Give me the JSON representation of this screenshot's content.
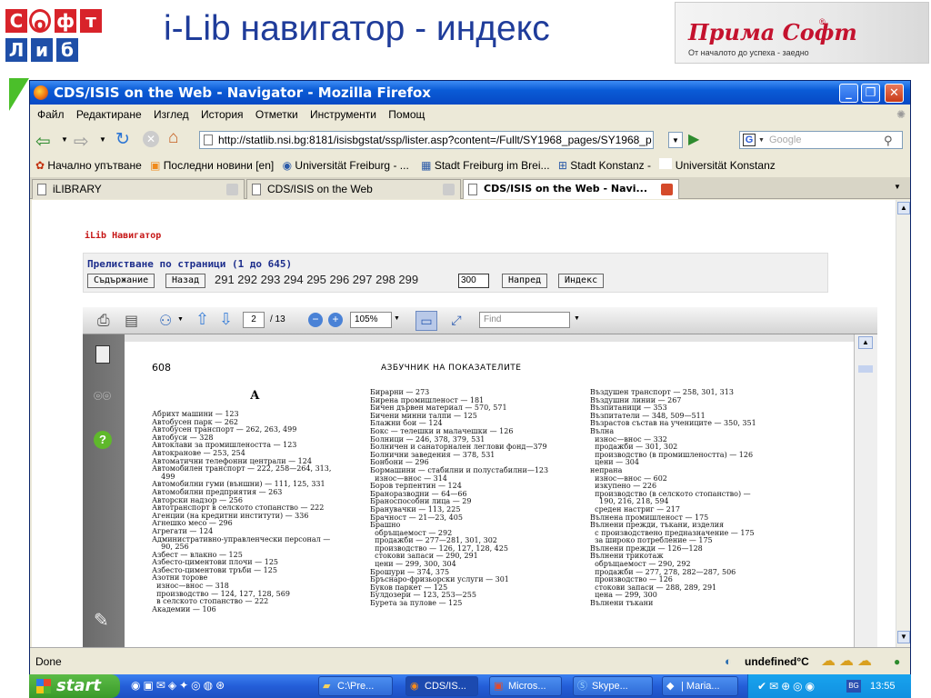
{
  "slide": {
    "logo_letters": [
      "С",
      "о",
      "ф",
      "т",
      "Л",
      "и",
      "б"
    ],
    "title": "i-Lib навигатор - индекс",
    "brand_name": "Прима Софт",
    "brand_reg": "®",
    "brand_tagline": "От началото до успеха - заедно"
  },
  "window": {
    "title": "CDS/ISIS on the Web - Navigator - Mozilla Firefox",
    "controls": [
      "minimize",
      "maximize",
      "close"
    ]
  },
  "menu": [
    "Файл",
    "Редактиране",
    "Изглед",
    "История",
    "Отметки",
    "Инструменти",
    "Помощ"
  ],
  "nav": {
    "url": "http://statlib.nsi.bg:8181/isisbgstat/ssp/lister.asp?content=/Fullt/SY1968_pages/SY1968_p",
    "search_engine_letter": "G",
    "search_placeholder": "Google"
  },
  "bookmarks": [
    "Начално упътване",
    "Последни новини [en]",
    "Universität Freiburg - ...",
    "Stadt Freiburg im Brei...",
    "Stadt Konstanz -",
    "Universität Konstanz"
  ],
  "tabs": [
    {
      "label": "iLIBRARY",
      "active": false
    },
    {
      "label": "CDS/ISIS on the Web",
      "active": false
    },
    {
      "label": "CDS/ISIS on the Web - Navi...",
      "active": true
    }
  ],
  "page": {
    "heading": "iLib Навигатор",
    "browse_label": "Прелистване по страници (1 до 645)",
    "contents_button": "Съдържание",
    "back_button": "Назад",
    "pages": "291 292 293 294 295 296 297 298 299",
    "page_input": "300",
    "next_button": "Напред",
    "index_button": "Индекс"
  },
  "pdf": {
    "page_current": "2",
    "page_total": "/ 13",
    "zoom": "105%",
    "find_placeholder": "Find",
    "doc_page_number": "608",
    "doc_heading": "АЗБУЧНИК НА ПОКАЗАТЕЛИТЕ",
    "doc_letter": "А",
    "col1": "Абрихт машини — 123\nАвтобусен парк — 262\nАвтобусен транспорт — 262, 263, 499\nАвтобуси — 328\nАвтоклави за промишлеността — 123\nАвтокранове — 253, 254\nАвтоматични телефонни централи — 124\nАвтомобилен транспорт — 222, 258—264, 313,\n    499\nАвтомобилни гуми (външни) — 111, 125, 331\nАвтомобилни предприятия — 263\nАвторски надзор — 256\nАвтотранспорт в селското стопанство — 222\nАгенции (на кредитни институти) — 336\nАгнешко месо — 296\nАгрегати — 124\nАдминистративно-управленчески персонал —\n    90, 256\nАзбест — влакно — 125\nАзбесто-циментови плочи — 125\nАзбесто-циментови тръби — 125\nАзотни торове\n  износ—внос — 318\n  производство — 124, 127, 128, 569\n  в селското стопанство — 222\nАкадемии — 106",
    "col2": "Бирарни — 273\nБирена промишленост — 181\nБичен дървен материал — 570, 571\nБичени минни талпи — 125\nБлажни бои — 124\nБокс — телешки и малачешки — 126\nБолници — 246, 378, 379, 531\nБолничен и санаторнален леглови фонд—379\nБолнични заведения — 378, 531\nБонбони — 296\nБормашини — стабилни и полустабилни—123\n  износ—внос — 314\nБоров терпентин — 124\nБраноразводни — 64—66\nБраноспособни лица — 29\nБранувачки — 113, 225\nБрачност — 21—23, 405\nБрашно\n  обръщаемост — 292\n  продажби — 277—281, 301, 302\n  производство — 126, 127, 128, 425\n  стокови запаси — 290, 291\n  цени — 299, 300, 304\nБрошури — 374, 375\nБръснаро-фризьорски услуги — 301\nБуков паркет — 125\nБулдозери — 123, 253—255\nБурета за пулове — 125",
    "col3": "Въздушен транспорт — 258, 301, 313\nВъздушни линии — 267\nВъзпитаници — 353\nВъзпитатели — 348, 509—511\nВъзрастов състав на учениците — 350, 351\nВълна\n  износ—внос — 332\n  продажби — 301, 302\n  производство (в промишлеността) — 126\n  цени — 304\nнепрана\n  износ—внос — 602\n  изкупено — 226\n  производство (в селското стопанство) —\n    190, 216, 218, 594\n  среден настриг — 217\nВълнена промишленост — 175\nВълнени прежди, тъкани, изделия\n  с производствено предназначение — 175\n  за широко потребление — 175\nВълнени прежди — 126—128\nВълнени трикотаж\n  обръщаемост — 290, 292\n  продажби — 277, 278, 282—287, 506\n  производство — 126\n  стокови запаси — 288, 289, 291\n  цена — 299, 300\nВълнени тъкани"
  },
  "status": {
    "text": "Done",
    "weather": "undefined°C"
  },
  "taskbar": {
    "start": "start",
    "tasks": [
      "C:\\Pre...",
      "CDS/IS...",
      "Micros...",
      "Skype...",
      "| Maria..."
    ],
    "lang": "BG",
    "clock": "13:55"
  }
}
